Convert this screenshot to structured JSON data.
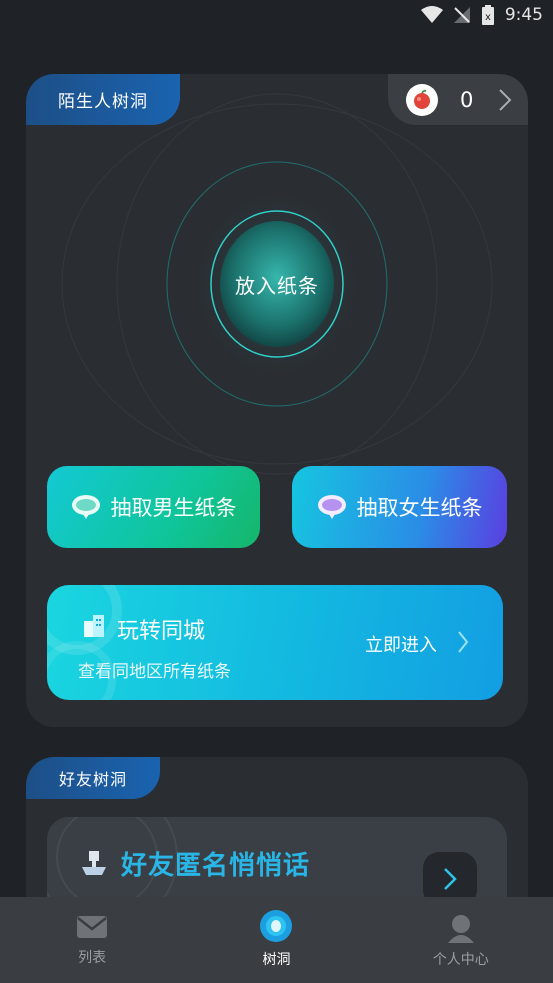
{
  "status_bar": {
    "time": "9:45"
  },
  "stranger": {
    "tag": "陌生人树洞",
    "coins": "0",
    "drop_label": "放入纸条",
    "pick_male": "抽取男生纸条",
    "pick_female": "抽取女生纸条",
    "city": {
      "title": "玩转同城",
      "subtitle": "查看同地区所有纸条",
      "enter": "立即进入"
    }
  },
  "friends": {
    "tag": "好友树洞",
    "banner_title": "好友匿名悄悄话"
  },
  "nav": [
    {
      "label": "列表",
      "icon": "mail-icon",
      "active": false
    },
    {
      "label": "树洞",
      "icon": "treehole-icon",
      "active": true
    },
    {
      "label": "个人中心",
      "icon": "person-icon",
      "active": false
    }
  ],
  "colors": {
    "background": "#1f2226",
    "card": "#2a2e33",
    "accent_cyan": "#14c9d4",
    "tag_blue": "#1a63b0",
    "nav_bg": "#3a3d41"
  }
}
